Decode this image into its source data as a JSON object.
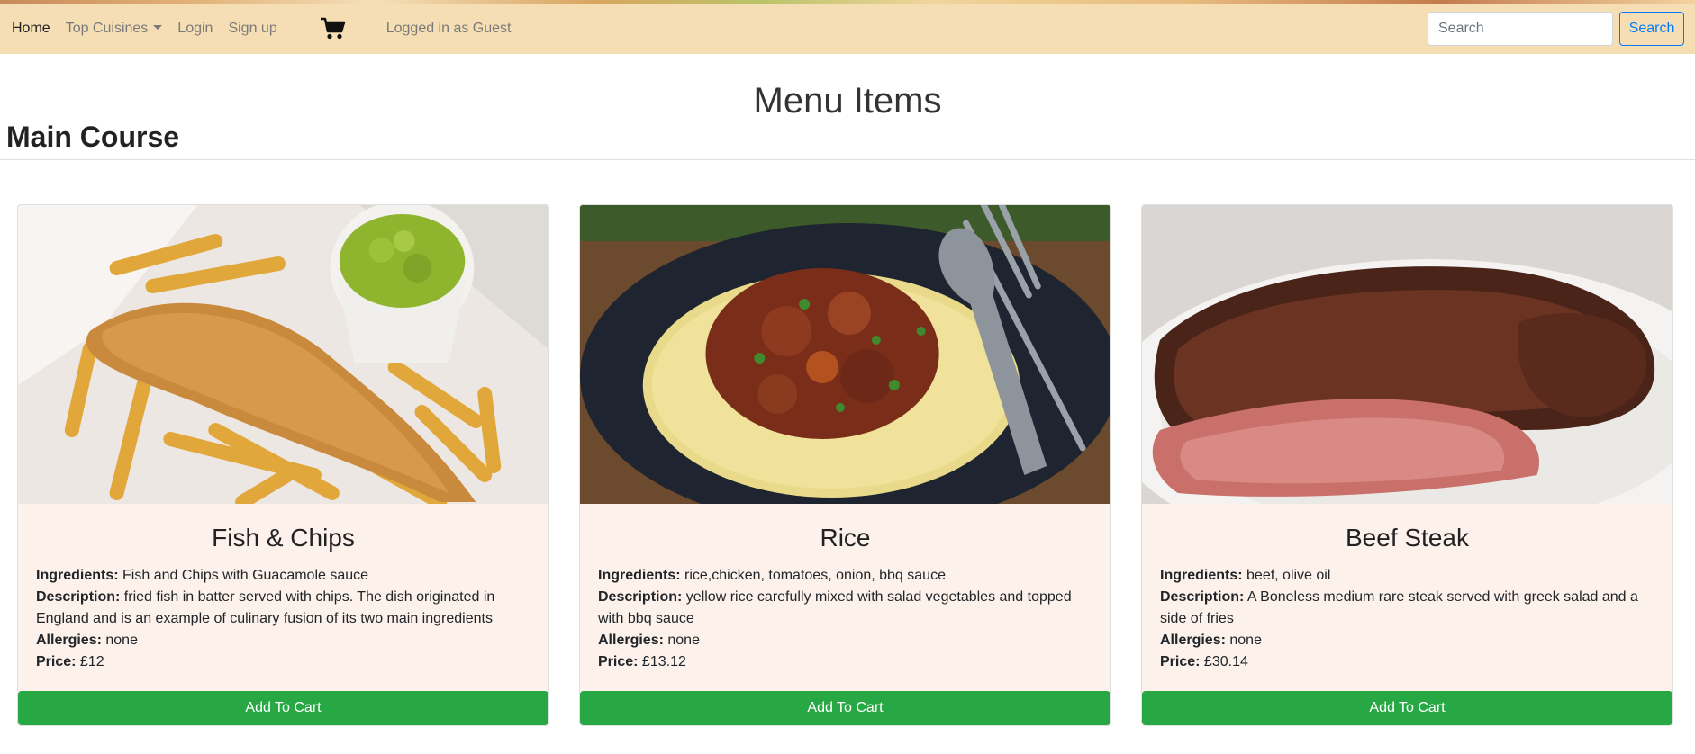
{
  "nav": {
    "home": "Home",
    "top_cuisines": "Top Cuisines",
    "login": "Login",
    "signup": "Sign up",
    "status": "Logged in as Guest"
  },
  "search": {
    "placeholder": "Search",
    "button": "Search"
  },
  "page": {
    "title": "Menu Items",
    "section": "Main Course"
  },
  "labels": {
    "ingredients": "Ingredients:",
    "description": "Description:",
    "allergies": "Allergies:",
    "price": "Price:",
    "add_to_cart": "Add To Cart"
  },
  "items": [
    {
      "name": "Fish & Chips",
      "ingredients": "Fish and Chips with Guacamole sauce",
      "description": "fried fish in batter served with chips. The dish originated in England and is an example of culinary fusion of its two main ingredients",
      "allergies": "none",
      "price": "£12"
    },
    {
      "name": "Rice",
      "ingredients": "rice,chicken, tomatoes, onion, bbq sauce",
      "description": "yellow rice carefully mixed with salad vegetables and topped with bbq sauce",
      "allergies": "none",
      "price": "£13.12"
    },
    {
      "name": "Beef Steak",
      "ingredients": "beef, olive oil",
      "description": "A Boneless medium rare steak served with greek salad and a side of fries",
      "allergies": "none",
      "price": "£30.14"
    }
  ],
  "colors": {
    "navbar": "#f5deb3",
    "card_bg": "#fdf1eb",
    "cart_button": "#28a745",
    "search_button": "#007bff"
  }
}
